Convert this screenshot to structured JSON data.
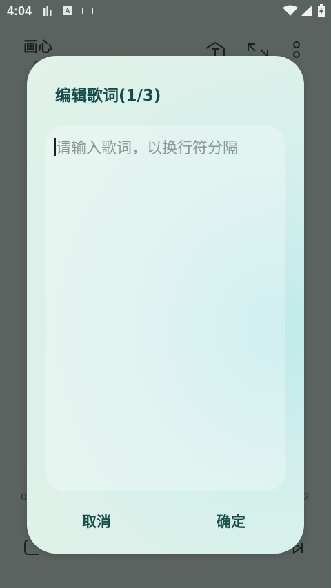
{
  "status_bar": {
    "time": "4:04",
    "notification_icons": [
      "bar-chart-icon",
      "a-badge-icon",
      "keyboard-icon"
    ],
    "system_icons": [
      "wifi-icon",
      "signal-icon",
      "battery-charging-icon"
    ]
  },
  "background": {
    "title": "画心",
    "subtitle": "《",
    "toolbar_icons": [
      "font-style-icon",
      "expand-icon",
      "more-vert-icon"
    ],
    "time_left": "0",
    "time_right": "2"
  },
  "dialog": {
    "title": "编辑歌词(1/3)",
    "input_value": "",
    "input_placeholder": "请输入歌词，以换行符分隔",
    "cancel_label": "取消",
    "confirm_label": "确定"
  }
}
